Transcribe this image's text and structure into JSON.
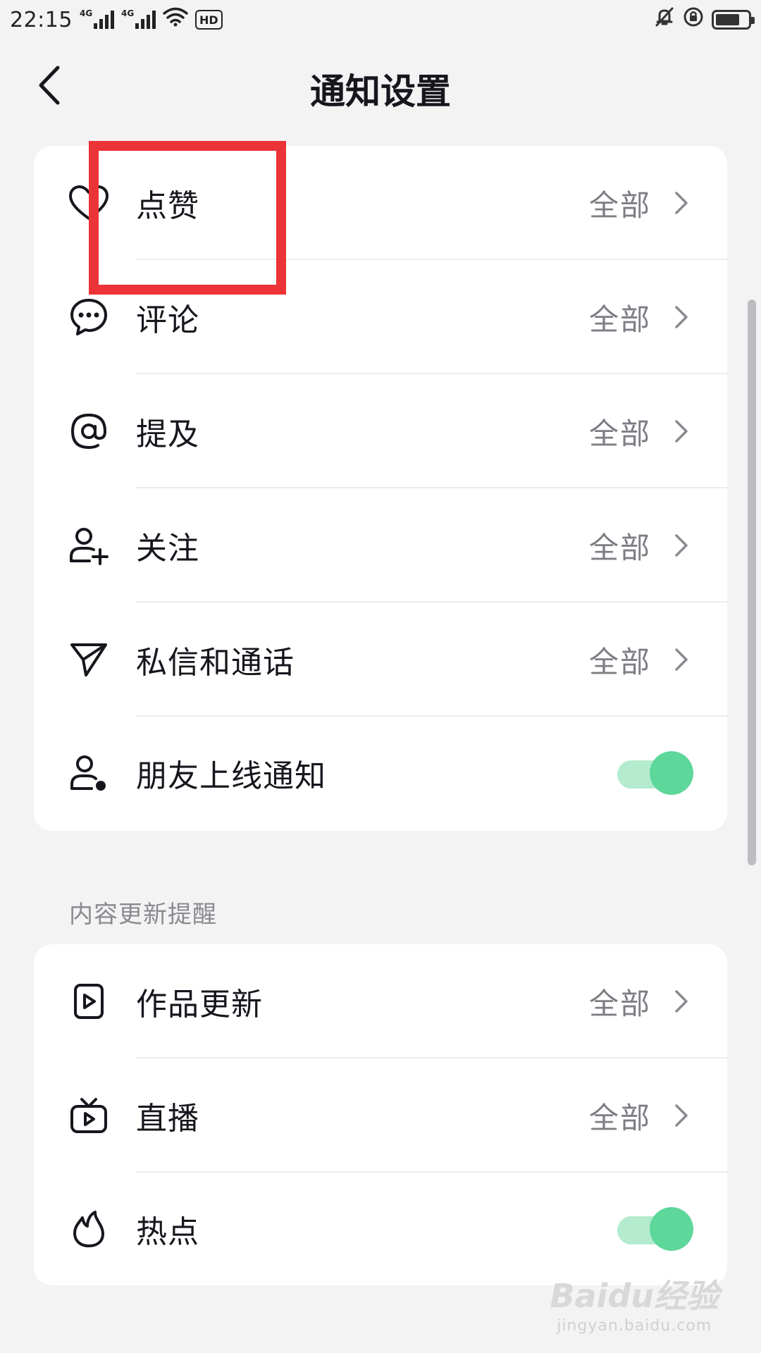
{
  "status_bar": {
    "time": "22:15",
    "network_1": "4G",
    "network_2": "4G",
    "hd_badge": "HD",
    "icons": [
      "signal-icon",
      "wifi-icon",
      "hd-icon",
      "mute-icon",
      "lock-rotation-icon",
      "battery-icon"
    ],
    "battery_level": 0.75
  },
  "header": {
    "back_icon": "chevron-left-icon",
    "title": "通知设置"
  },
  "notifications": {
    "items": [
      {
        "label": "点赞",
        "value": "全部",
        "icon": "heart-icon"
      },
      {
        "label": "评论",
        "value": "全部",
        "icon": "comment-icon"
      },
      {
        "label": "提及",
        "value": "全部",
        "icon": "at-icon"
      },
      {
        "label": "关注",
        "value": "全部",
        "icon": "follow-user-icon"
      },
      {
        "label": "私信和通话",
        "value": "全部",
        "icon": "send-icon"
      },
      {
        "label": "朋友上线通知",
        "toggle": true,
        "icon": "user-online-icon"
      }
    ]
  },
  "content_updates": {
    "section_title": "内容更新提醒",
    "items": [
      {
        "label": "作品更新",
        "value": "全部",
        "icon": "video-icon"
      },
      {
        "label": "直播",
        "value": "全部",
        "icon": "tv-live-icon"
      },
      {
        "label": "热点",
        "toggle": true,
        "icon": "flame-icon"
      }
    ]
  },
  "colors": {
    "toggle_on": "#5ed79a",
    "toggle_track": "#b4ebcf",
    "highlight": "#ec3338",
    "background": "#f3f3f4"
  },
  "watermark": {
    "logo": "Baidu经验",
    "sub": "jingyan.baidu.com"
  }
}
